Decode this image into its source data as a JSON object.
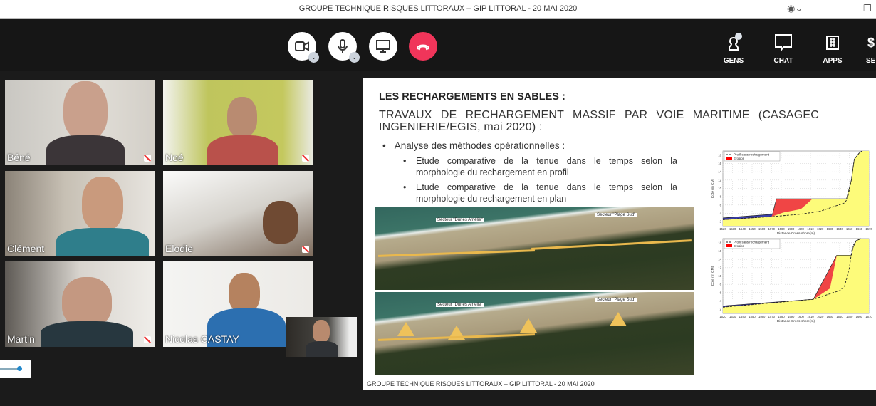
{
  "window": {
    "title": "GROUPE TECHNIQUE RISQUES LITTORAUX – GIP LITTORAL - 20 MAI 2020"
  },
  "toolbar": {
    "right": [
      {
        "label": "GENS",
        "icon": "people-icon"
      },
      {
        "label": "CHAT",
        "icon": "chat-icon"
      },
      {
        "label": "APPS",
        "icon": "apps-icon"
      },
      {
        "label": "SE"
      }
    ],
    "colors": {
      "hangup": "#f0355a",
      "bg": "#161616"
    }
  },
  "participants": [
    {
      "name": "Béné"
    },
    {
      "name": "Noé"
    },
    {
      "name": "Clément"
    },
    {
      "name": "Elodie"
    },
    {
      "name": "Martin"
    },
    {
      "name": "Nicolas CASTAY"
    }
  ],
  "slide": {
    "title": "LES RECHARGEMENTS EN SABLES :",
    "subtitle": "TRAVAUX DE RECHARGEMENT MASSIF PAR VOIE MARITIME (CASAGEC INGENIERIE/EGIS, mai 2020) :",
    "bullet": "Analyse des méthodes opérationnelles :",
    "subbullets": [
      "Etude comparative de la tenue dans le temps selon la morphologie du rechargement en profil",
      "Etude comparative de la tenue dans le temps selon la morphologie du rechargement en plan"
    ],
    "map_labels": [
      "Secteur \"Dunes Amélie\"",
      "Secteur \"Plage Sud\""
    ],
    "footer": "GROUPE TECHNIQUE RISQUES LITTORAUX – GIP LITTORAL - 20 MAI 2020"
  },
  "chart_data": [
    {
      "type": "area",
      "xlabel": "Distance Cross-shore(m)",
      "ylabel": "Cote (m CM)",
      "xlim": [
        1520,
        1670
      ],
      "ylim": [
        1,
        19
      ],
      "xticks": [
        1520,
        1530,
        1540,
        1550,
        1560,
        1570,
        1580,
        1590,
        1600,
        1610,
        1620,
        1630,
        1640,
        1650,
        1660,
        1670
      ],
      "yticks": [
        2,
        4,
        6,
        8,
        10,
        12,
        14,
        16,
        18
      ],
      "legend": [
        "Profil sans rechargement",
        "Erosion"
      ],
      "grid": true,
      "profil_sans_rechargement": [
        [
          1520,
          2.5
        ],
        [
          1570,
          3.2
        ],
        [
          1600,
          3.8
        ],
        [
          1620,
          4.5
        ],
        [
          1645,
          6.5
        ],
        [
          1648,
          7.5
        ],
        [
          1652,
          12
        ],
        [
          1655,
          17
        ],
        [
          1660,
          18.5
        ],
        [
          1663,
          19
        ]
      ],
      "profil_initial": [
        [
          1520,
          2.9
        ],
        [
          1571,
          3.8
        ],
        [
          1575,
          7.5
        ],
        [
          1647,
          7.5
        ],
        [
          1652,
          12
        ],
        [
          1655,
          17
        ],
        [
          1660,
          18.5
        ],
        [
          1663,
          19
        ]
      ],
      "profil_final": [
        [
          1520,
          2.4
        ],
        [
          1570,
          3.2
        ],
        [
          1582,
          4.2
        ],
        [
          1600,
          5
        ],
        [
          1605,
          6
        ],
        [
          1612,
          7.5
        ],
        [
          1647,
          7.5
        ],
        [
          1652,
          12
        ],
        [
          1655,
          17
        ],
        [
          1660,
          18.5
        ],
        [
          1663,
          19
        ]
      ]
    },
    {
      "type": "area",
      "xlabel": "Distance Cross-shore(m)",
      "ylabel": "Cote (m CM)",
      "xlim": [
        1520,
        1670
      ],
      "ylim": [
        1,
        19
      ],
      "xticks": [
        1520,
        1530,
        1540,
        1550,
        1560,
        1570,
        1580,
        1590,
        1600,
        1610,
        1620,
        1630,
        1640,
        1650,
        1660,
        1670
      ],
      "yticks": [
        2,
        4,
        6,
        8,
        10,
        12,
        14,
        16,
        18
      ],
      "legend": [
        "Profil sans rechargement",
        "Erosion"
      ],
      "grid": true,
      "profil_sans_rechargement": [
        [
          1520,
          2.5
        ],
        [
          1613,
          4.4
        ],
        [
          1640,
          6.5
        ],
        [
          1645,
          7.5
        ],
        [
          1650,
          12
        ],
        [
          1653,
          17
        ],
        [
          1657,
          18.5
        ],
        [
          1662,
          19
        ]
      ],
      "profil_initial": [
        [
          1520,
          2.8
        ],
        [
          1613,
          4.4
        ],
        [
          1637,
          15
        ],
        [
          1652,
          15
        ],
        [
          1654,
          17
        ],
        [
          1657,
          18.5
        ],
        [
          1662,
          19
        ]
      ],
      "profil_final": [
        [
          1520,
          2.5
        ],
        [
          1613,
          4.4
        ],
        [
          1630,
          7
        ],
        [
          1637,
          15
        ],
        [
          1652,
          15
        ],
        [
          1654,
          17
        ],
        [
          1657,
          18.5
        ],
        [
          1662,
          19
        ]
      ]
    }
  ]
}
